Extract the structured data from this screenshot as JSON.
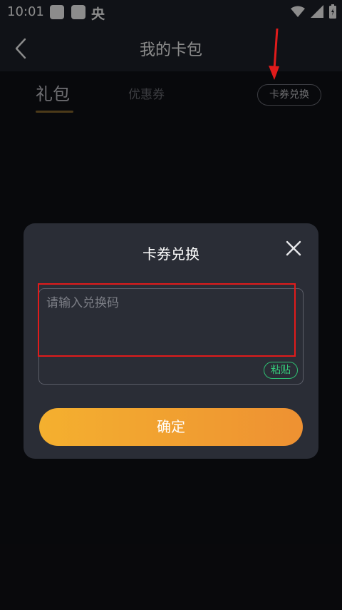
{
  "status_bar": {
    "time": "10:01",
    "app_glyph": "央"
  },
  "app_bar": {
    "title": "我的卡包"
  },
  "tabs": [
    {
      "label": "礼包",
      "active": true
    },
    {
      "label": "优惠券",
      "active": false
    }
  ],
  "redeem_button": {
    "label": "卡券兑换"
  },
  "dialog": {
    "title": "卡券兑换",
    "input_placeholder": "请输入兑换码",
    "input_value": "",
    "paste_label": "粘贴",
    "confirm_label": "确定"
  },
  "colors": {
    "accent_gradient_start": "#f4b02f",
    "accent_gradient_end": "#ee9132",
    "paste_green": "#35c97a",
    "annotation_red": "#e11b1b"
  },
  "icons": [
    "back-arrow-icon",
    "wifi-icon",
    "signal-icon",
    "battery-icon",
    "close-icon"
  ]
}
